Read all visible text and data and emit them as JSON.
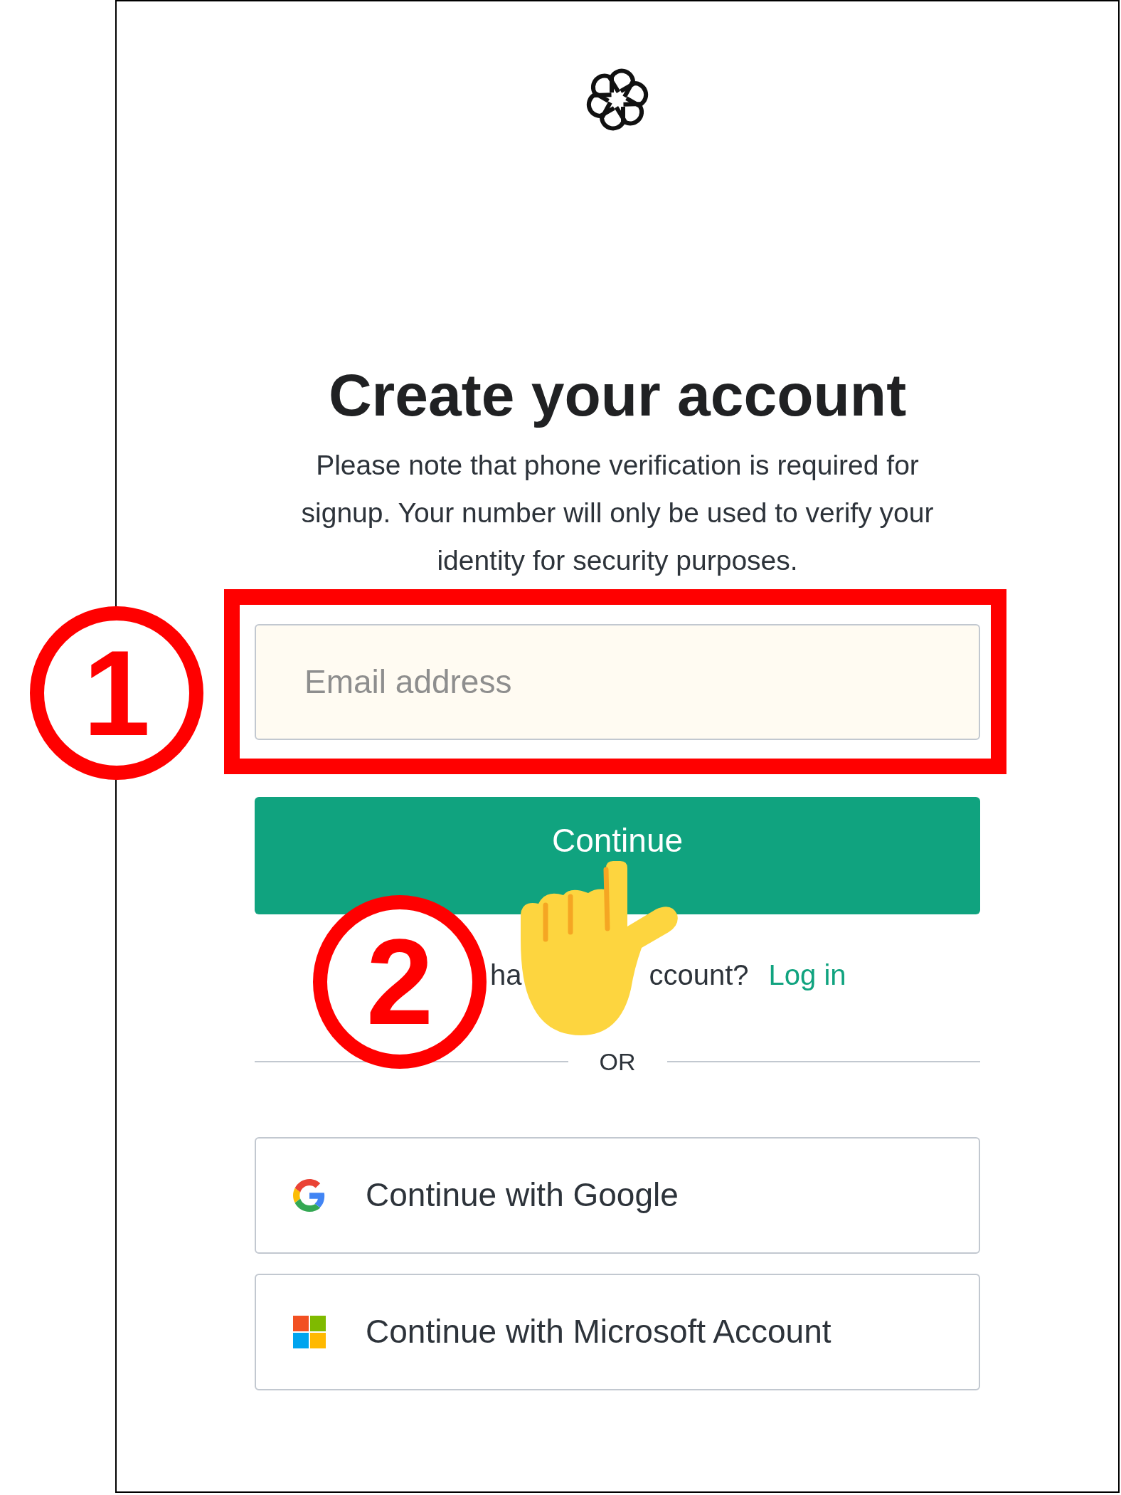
{
  "title": "Create your account",
  "note": "Please note that phone verification is required for signup. Your number will only be used to verify your identity for security purposes.",
  "email_field": {
    "placeholder": "Email address"
  },
  "continue_button": "Continue",
  "login_line": {
    "visible_parts": [
      "ha",
      "ccount?"
    ],
    "link": "Log in"
  },
  "divider": "OR",
  "social_buttons": [
    {
      "kind": "google",
      "label": "Continue with Google"
    },
    {
      "kind": "microsoft",
      "label": "Continue with Microsoft Account"
    }
  ],
  "annotations": {
    "markers": [
      "1",
      "2"
    ]
  }
}
